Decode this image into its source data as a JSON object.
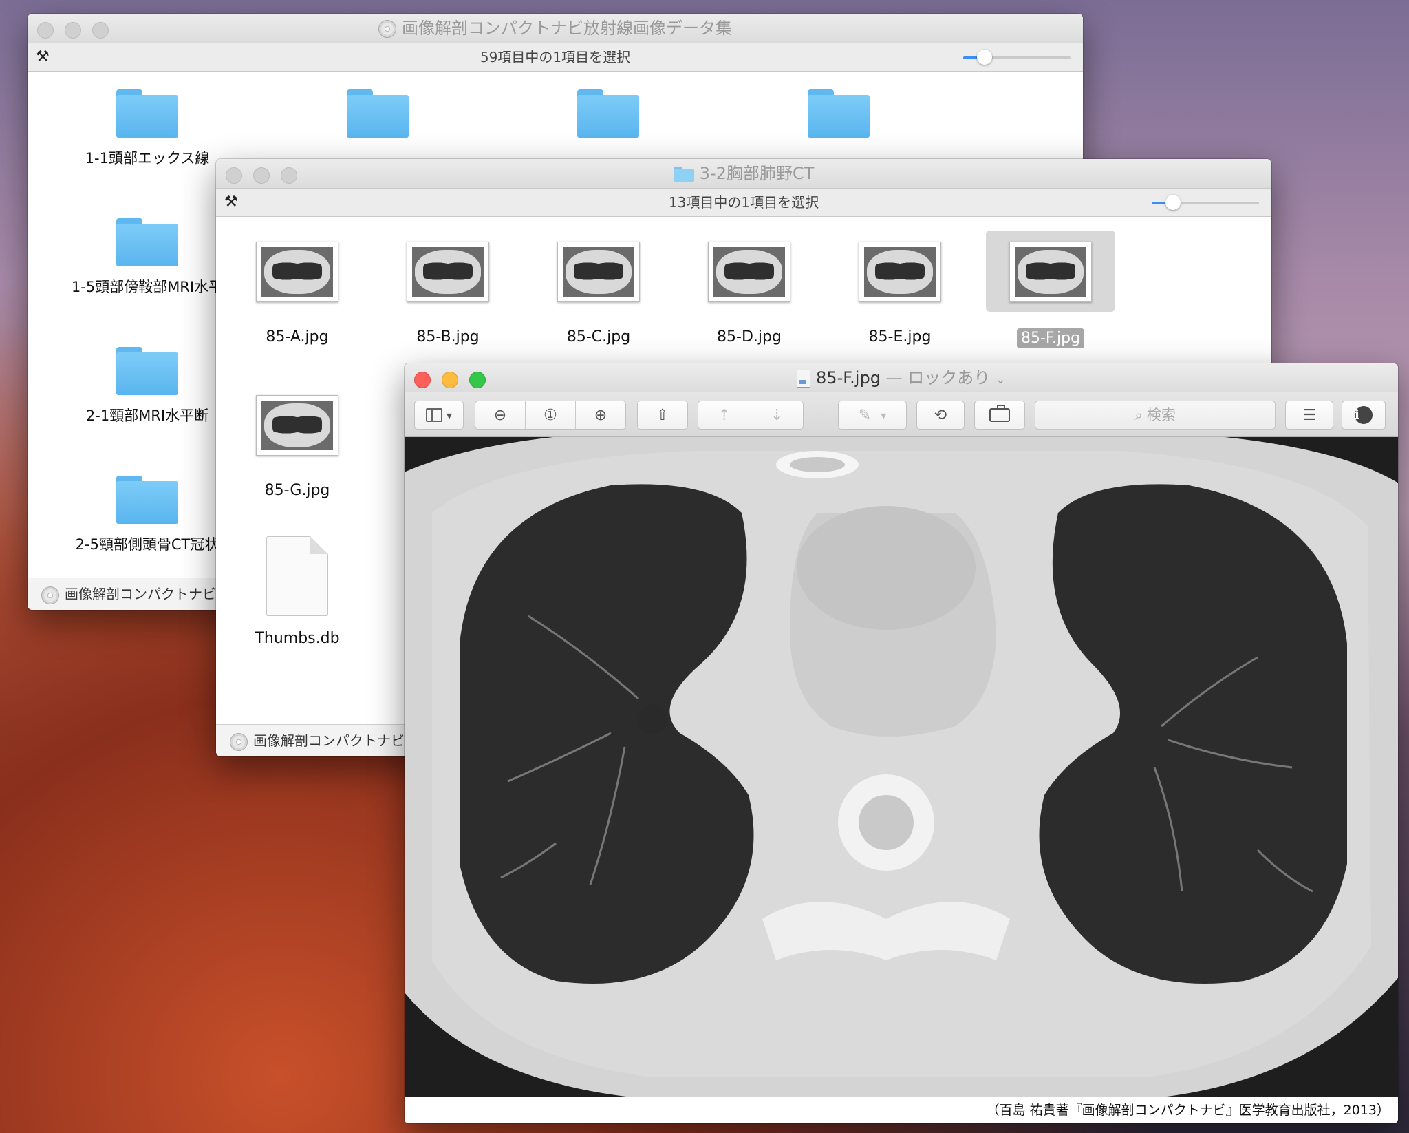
{
  "back_window": {
    "title": "画像解剖コンパクトナビ放射線画像データ集",
    "status": "59項目中の1項目を選択",
    "items": [
      {
        "label": "1-1頭部エックス線"
      },
      {
        "label": ""
      },
      {
        "label": ""
      },
      {
        "label": ""
      },
      {
        "label": "1-5頭部傍鞍部MRI水平"
      },
      {
        "label": "2-1頸部MRI水平断"
      },
      {
        "label": "2-5頸部側頭骨CT冠状"
      }
    ],
    "path": "画像解剖コンパクトナビ"
  },
  "middle_window": {
    "title": "3-2胸部肺野CT",
    "status": "13項目中の1項目を選択",
    "files": [
      {
        "label": "85-A.jpg"
      },
      {
        "label": "85-B.jpg"
      },
      {
        "label": "85-C.jpg"
      },
      {
        "label": "85-D.jpg"
      },
      {
        "label": "85-E.jpg"
      },
      {
        "label": "85-F.jpg"
      },
      {
        "label": "85-G.jpg"
      },
      {
        "label": "Thumbs.db"
      }
    ],
    "path": "画像解剖コンパクトナビ"
  },
  "preview": {
    "filename": "85-F.jpg",
    "lock_status": "— ロックあり",
    "search_placeholder": "検索",
    "caption": "（百島 祐貴著『画像解剖コンパクトナビ』医学教育出版社，2013）"
  },
  "colors": {
    "folder": "#6ec0f4",
    "selection": "#a7a7a7",
    "accent": "#3b8cf5"
  }
}
